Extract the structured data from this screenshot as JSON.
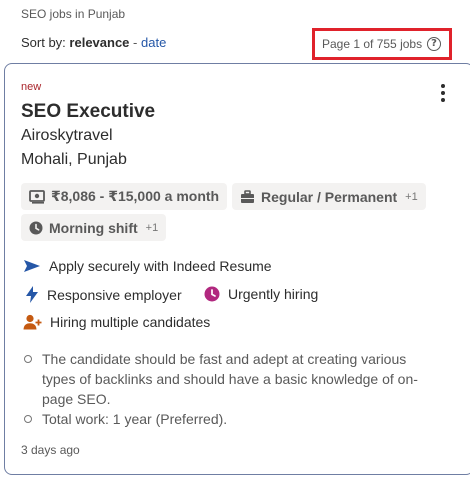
{
  "breadcrumb": "SEO jobs in Punjab",
  "sort": {
    "prefix": "Sort by:",
    "active": "relevance",
    "separator": "-",
    "alternate": "date"
  },
  "page_count": "Page 1 of 755 jobs",
  "job": {
    "badge": "new",
    "title": "SEO Executive",
    "company": "Airoskytravel",
    "location": "Mohali, Punjab",
    "salary": "₹8,086 - ₹15,000 a month",
    "job_type": "Regular / Permanent",
    "job_type_more": "+1",
    "shift": "Morning shift",
    "shift_more": "+1",
    "features": {
      "apply": "Apply securely with Indeed Resume",
      "responsive": "Responsive employer",
      "urgent": "Urgently hiring",
      "multiple": "Hiring multiple candidates"
    },
    "snippet": [
      "The candidate should be fast and adept at creating various types of backlinks and should have a basic knowledge of on-page SEO.",
      "Total work: 1 year (Preferred)."
    ],
    "posted": "3 days ago"
  },
  "colors": {
    "link": "#2557a7",
    "new_badge": "#a9252b",
    "highlight_box": "#e0222b",
    "urgent_icon": "#b1287f",
    "multiple_icon": "#c55a11"
  },
  "icons": [
    "help-icon",
    "kebab-menu-icon",
    "money-icon",
    "briefcase-icon",
    "clock-icon",
    "send-arrow-icon",
    "lightning-icon",
    "urgent-clock-icon",
    "add-person-icon"
  ]
}
